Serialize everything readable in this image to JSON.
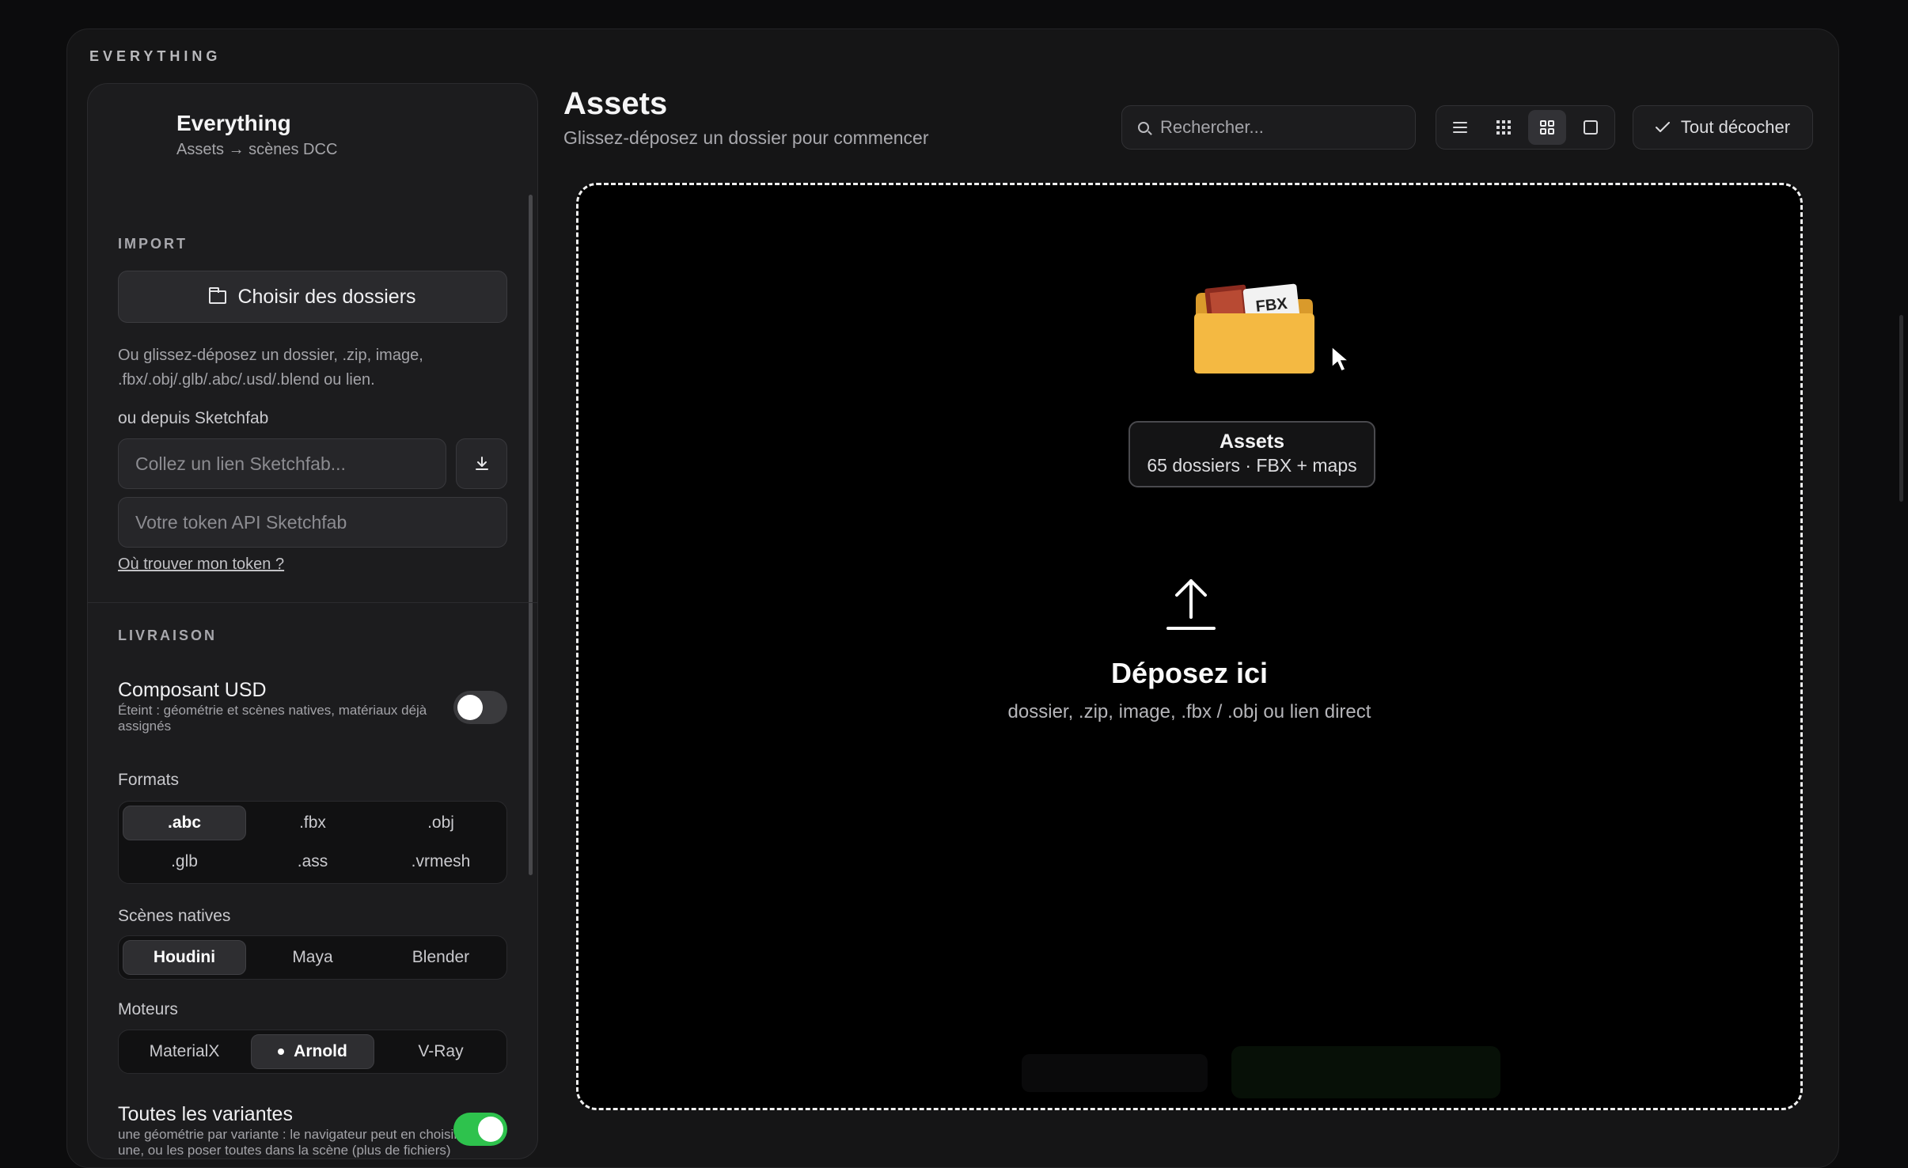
{
  "app": {
    "title": "EVERYTHING"
  },
  "sidebar": {
    "brand_name": "Everything",
    "brand_sub": "Assets → scènes DCC",
    "import": {
      "label": "IMPORT",
      "choose_button": "Choisir des dossiers",
      "hint": "Ou glissez-déposez un dossier, .zip, image, .fbx/.obj/.glb/.abc/.usd/.blend ou lien.",
      "sketchfab_label": "ou depuis Sketchfab",
      "link_placeholder": "Collez un lien Sketchfab...",
      "token_placeholder": "Votre token API Sketchfab",
      "token_help": "Où trouver mon token ?"
    },
    "delivery": {
      "label": "LIVRAISON",
      "usd_title": "Composant USD",
      "usd_desc": "Éteint : géométrie et scènes natives, matériaux déjà assignés",
      "usd_enabled": false,
      "formats_label": "Formats",
      "formats": [
        ".abc",
        ".fbx",
        ".obj",
        ".glb",
        ".ass",
        ".vrmesh"
      ],
      "formats_selected": ".abc",
      "scenes_label": "Scènes natives",
      "scenes": [
        "Houdini",
        "Maya",
        "Blender"
      ],
      "scenes_selected": "Houdini",
      "engines_label": "Moteurs",
      "engines": [
        "MaterialX",
        "Arnold",
        "V-Ray"
      ],
      "engines_selected": "Arnold",
      "variants_title": "Toutes les variantes",
      "variants_desc": "une géométrie par variante : le navigateur peut en choisir une, ou les poser toutes dans la scène (plus de fichiers)",
      "variants_enabled": true
    }
  },
  "main": {
    "title": "Assets",
    "subtitle": "Glissez-déposez un dossier pour commencer",
    "search_placeholder": "Rechercher...",
    "view_modes": [
      "list-icon",
      "grid-small-icon",
      "grid-large-icon",
      "single-icon"
    ],
    "view_selected": "grid-large-icon",
    "uncheck_all": "Tout décocher",
    "dropzone": {
      "drag_item_badge": "FBX",
      "drag_item_title": "Assets",
      "drag_item_sub": "65 dossiers · FBX + maps",
      "title": "Déposez ici",
      "subtitle": "dossier, .zip, image, .fbx / .obj ou lien direct"
    }
  },
  "colors": {
    "accent_green": "#2ec24d",
    "folder_yellow": "#f4b942",
    "background": "#0c0c0d"
  }
}
